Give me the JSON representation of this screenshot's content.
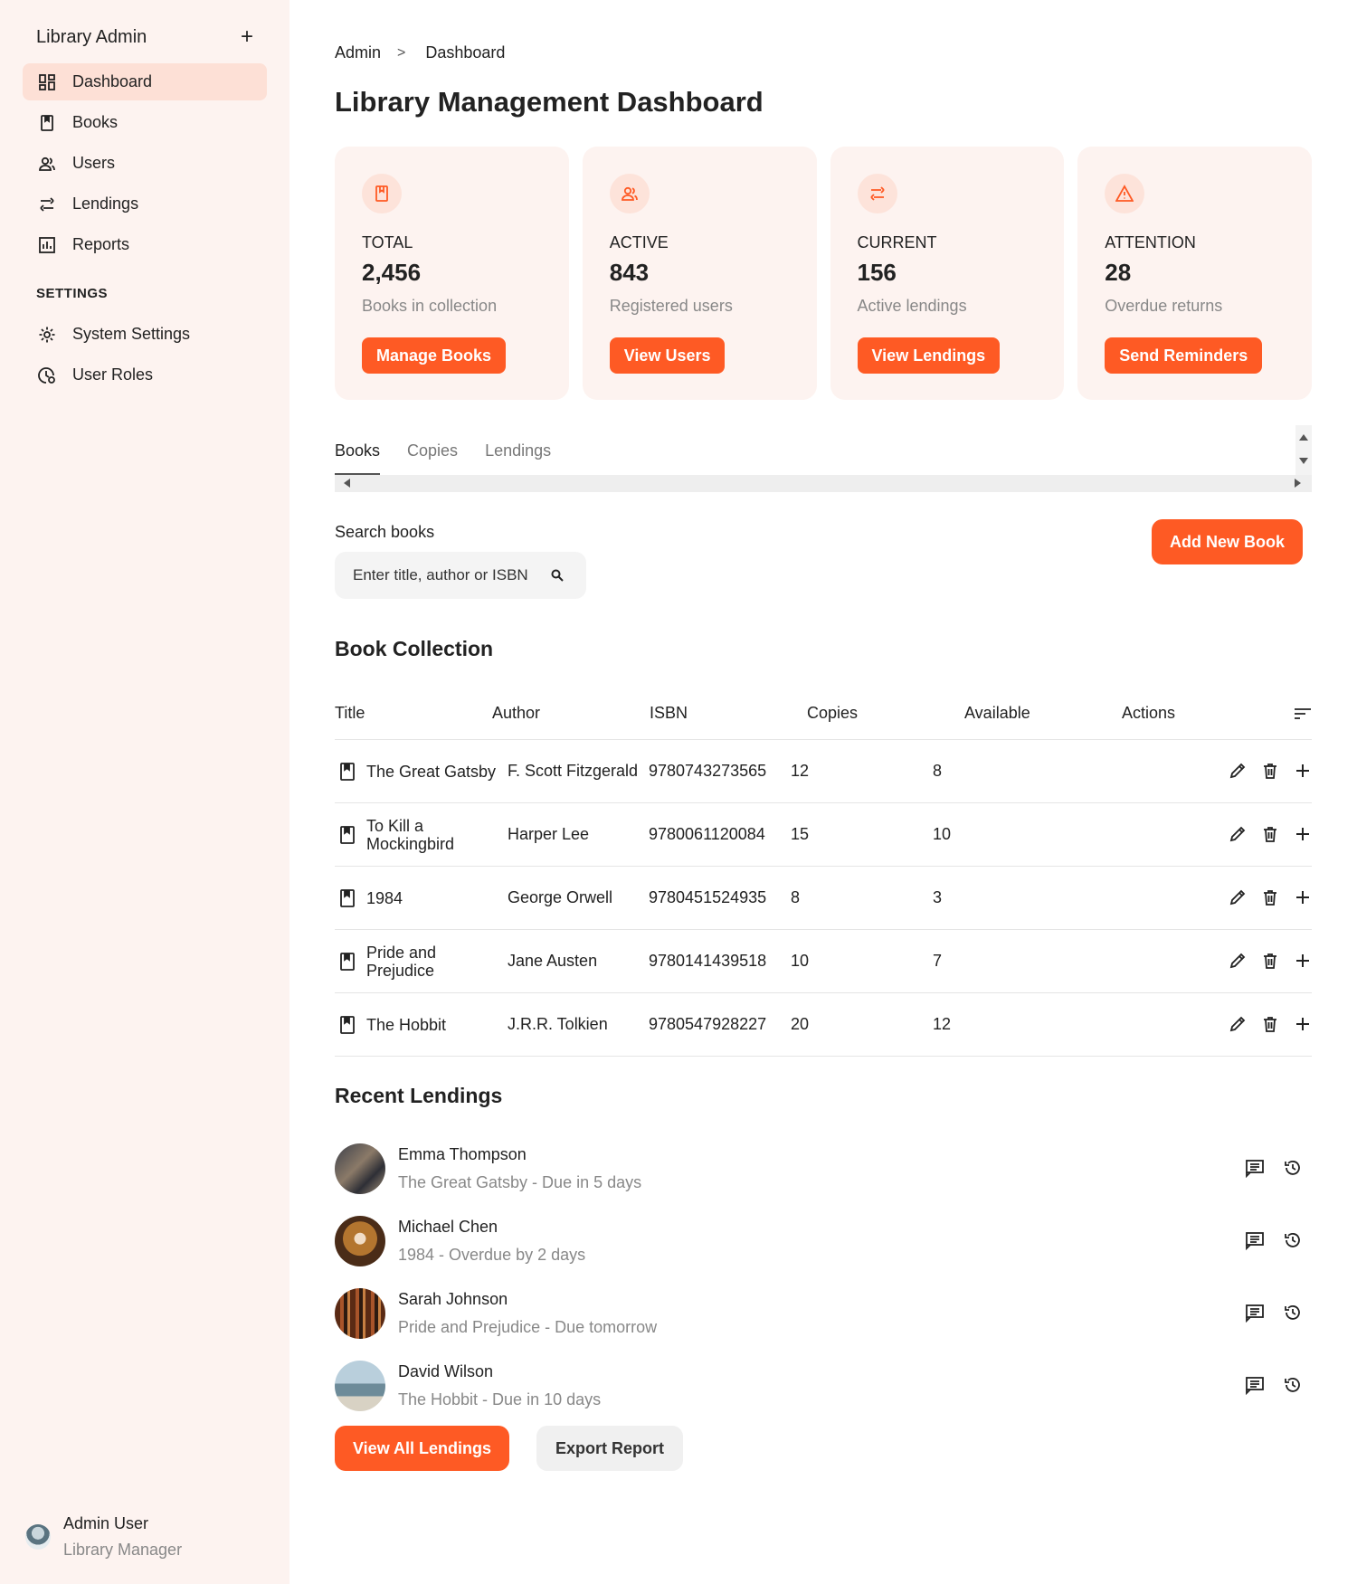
{
  "sidebar": {
    "title": "Library Admin",
    "add_icon": "+",
    "items": [
      {
        "label": "Dashboard",
        "icon": "dashboard-icon"
      },
      {
        "label": "Books",
        "icon": "book-icon"
      },
      {
        "label": "Users",
        "icon": "users-icon"
      },
      {
        "label": "Lendings",
        "icon": "swap-icon"
      },
      {
        "label": "Reports",
        "icon": "chart-icon"
      }
    ],
    "settings_header": "SETTINGS",
    "settings_items": [
      {
        "label": "System Settings",
        "icon": "gear-icon"
      },
      {
        "label": "User Roles",
        "icon": "role-icon"
      }
    ],
    "user": {
      "name": "Admin User",
      "role": "Library Manager"
    }
  },
  "breadcrumb": {
    "root": "Admin",
    "separator": ">",
    "current": "Dashboard"
  },
  "page_title": "Library Management Dashboard",
  "cards": [
    {
      "label": "TOTAL",
      "value": "2,456",
      "desc": "Books in collection",
      "button": "Manage Books",
      "icon": "book-icon"
    },
    {
      "label": "ACTIVE",
      "value": "843",
      "desc": "Registered users",
      "button": "View Users",
      "icon": "users-icon"
    },
    {
      "label": "CURRENT",
      "value": "156",
      "desc": "Active lendings",
      "button": "View Lendings",
      "icon": "swap-icon"
    },
    {
      "label": "ATTENTION",
      "value": "28",
      "desc": "Overdue returns",
      "button": "Send Reminders",
      "icon": "warning-icon"
    }
  ],
  "tabs": [
    "Books",
    "Copies",
    "Lendings"
  ],
  "search": {
    "label": "Search books",
    "placeholder": "Enter title, author or ISBN"
  },
  "add_button": "Add New Book",
  "collection": {
    "title": "Book Collection",
    "headers": [
      "Title",
      "Author",
      "ISBN",
      "Copies",
      "Available",
      "Actions"
    ],
    "rows": [
      {
        "title": "The Great Gatsby",
        "author": "F. Scott Fitzgerald",
        "isbn": "9780743273565",
        "copies": "12",
        "available": "8"
      },
      {
        "title": "To Kill a Mockingbird",
        "author": "Harper Lee",
        "isbn": "9780061120084",
        "copies": "15",
        "available": "10"
      },
      {
        "title": "1984",
        "author": "George Orwell",
        "isbn": "9780451524935",
        "copies": "8",
        "available": "3"
      },
      {
        "title": "Pride and Prejudice",
        "author": "Jane Austen",
        "isbn": "9780141439518",
        "copies": "10",
        "available": "7"
      },
      {
        "title": "The Hobbit",
        "author": "J.R.R. Tolkien",
        "isbn": "9780547928227",
        "copies": "20",
        "available": "12"
      }
    ]
  },
  "recent": {
    "title": "Recent Lendings",
    "items": [
      {
        "name": "Emma Thompson",
        "detail": "The Great Gatsby - Due in 5 days"
      },
      {
        "name": "Michael Chen",
        "detail": "1984 - Overdue by 2 days"
      },
      {
        "name": "Sarah Johnson",
        "detail": "Pride and Prejudice - Due tomorrow"
      },
      {
        "name": "David Wilson",
        "detail": "The Hobbit - Due in 10 days"
      }
    ]
  },
  "footer_buttons": {
    "primary": "View All Lendings",
    "secondary": "Export Report"
  },
  "colors": {
    "accent": "#fe5a24",
    "sidebar_bg": "#fdf3f0",
    "card_bg": "#fdf3f0",
    "active_nav": "#fde0d6"
  }
}
